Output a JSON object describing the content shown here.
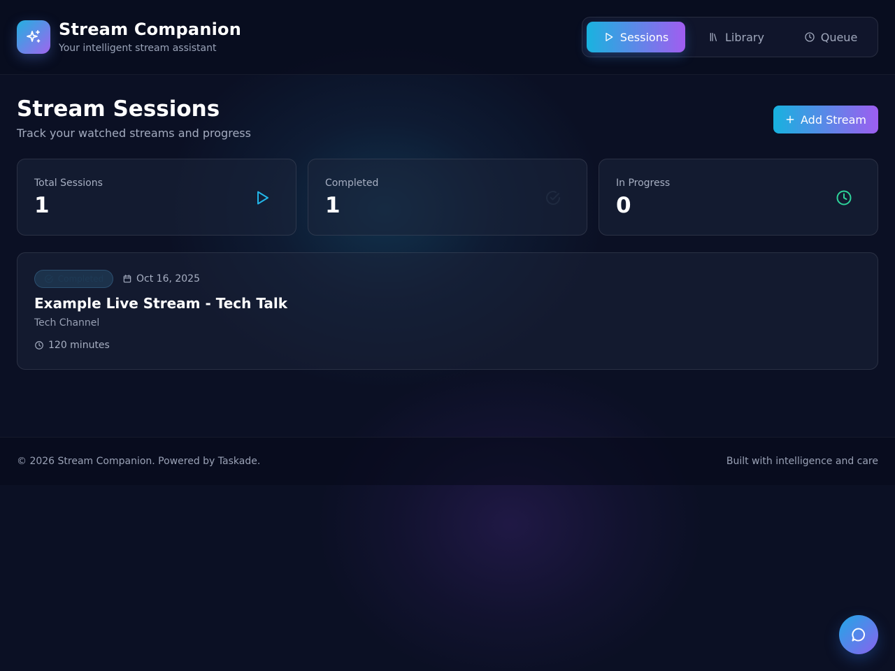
{
  "app": {
    "title": "Stream Companion",
    "subtitle": "Your intelligent stream assistant",
    "logo_icon": "sparkles-icon"
  },
  "nav": {
    "tabs": [
      {
        "label": "Sessions",
        "icon": "play-icon",
        "active": true
      },
      {
        "label": "Library",
        "icon": "library-icon",
        "active": false
      },
      {
        "label": "Queue",
        "icon": "clock-icon",
        "active": false
      }
    ]
  },
  "page": {
    "title": "Stream Sessions",
    "subtitle": "Track your watched streams and progress",
    "add_button_label": "Add Stream"
  },
  "stats": [
    {
      "label": "Total Sessions",
      "value": "1",
      "icon": "play-icon",
      "color": "#22b6e8"
    },
    {
      "label": "Completed",
      "value": "1",
      "icon": "check-circle-icon",
      "color": "#1f2a40"
    },
    {
      "label": "In Progress",
      "value": "0",
      "icon": "clock-icon",
      "color": "#2ed39a"
    }
  ],
  "sessions": [
    {
      "status": "Completed",
      "date": "Oct 16, 2025",
      "title": "Example Live Stream - Tech Talk",
      "channel": "Tech Channel",
      "duration": "120 minutes"
    }
  ],
  "footer": {
    "left": "© 2026 Stream Companion. Powered by Taskade.",
    "right": "Built with intelligence and care"
  },
  "chat": {
    "icon": "chat-bubble-icon"
  },
  "colors": {
    "accent_start": "#17b2df",
    "accent_end": "#a15df0",
    "background": "#0b1024"
  }
}
